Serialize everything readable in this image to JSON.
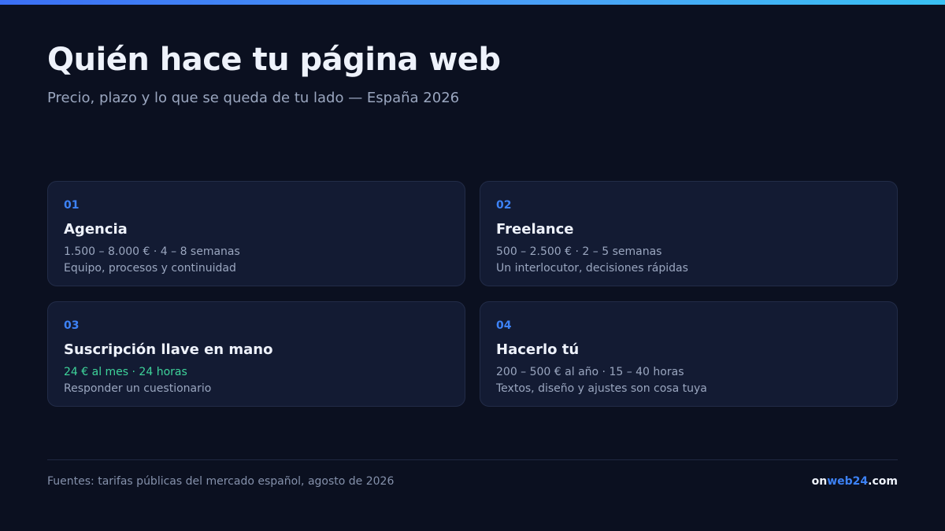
{
  "header": {
    "title": "Quién hace tu página web",
    "subtitle": "Precio, plazo y lo que se queda de tu lado — España 2026"
  },
  "cards": [
    {
      "number": "01",
      "title": "Agencia",
      "meta": "1.500 – 8.000 € · 4 – 8 semanas",
      "description": "Equipo, procesos y continuidad"
    },
    {
      "number": "02",
      "title": "Freelance",
      "meta": "500 – 2.500 € · 2 – 5 semanas",
      "description": "Un interlocutor, decisiones rápidas"
    },
    {
      "number": "03",
      "title": "Suscripción llave en mano",
      "meta": "24 € al mes · 24 horas",
      "description": "Responder un cuestionario"
    },
    {
      "number": "04",
      "title": "Hacerlo tú",
      "meta": "200 – 500 € al año · 15 – 40 horas",
      "description": "Textos, diseño y ajustes son cosa tuya"
    }
  ],
  "footer": {
    "sources": "Fuentes: tarifas públicas del mercado español, agosto de 2026",
    "brand_prefix": "on",
    "brand_accent": "web24",
    "brand_suffix": ".com"
  },
  "colors": {
    "background": "#0b1020",
    "card": "#131b33",
    "accent_blue": "#3d82f6",
    "accent_green": "#3ed39a"
  }
}
